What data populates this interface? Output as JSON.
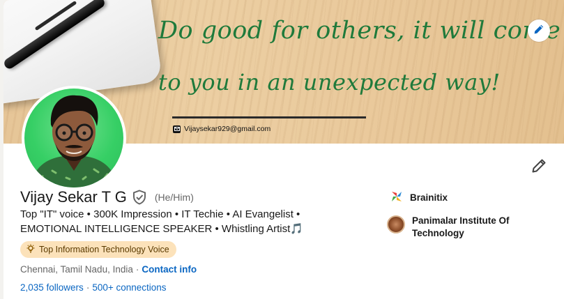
{
  "banner": {
    "quote_line1": "Do good for others, it will come back",
    "quote_line2": "to you in an unexpected way!",
    "email": "Vijaysekar929@gmail.com",
    "accent_color": "#1f7a3b"
  },
  "profile": {
    "name": "Vijay Sekar T G",
    "pronouns": "(He/Him)",
    "headline": "Top \"IT\" voice • 300K Impression • IT Techie • AI Evangelist • EMOTIONAL INTELLIGENCE SPEAKER • Whistling Artist",
    "headline_emoji": "🎵",
    "badge": "Top Information Technology Voice",
    "location": "Chennai, Tamil Nadu, India",
    "location_separator": "·",
    "contact_link": "Contact info",
    "followers": "2,035 followers",
    "stats_separator": "·",
    "connections": "500+ connections"
  },
  "organizations": [
    {
      "name": "Brainitix"
    },
    {
      "name": "Panimalar Institute Of Technology"
    }
  ],
  "icons": {
    "banner_edit": "pencil-icon",
    "profile_edit": "pencil-icon",
    "verified": "shield-check-icon",
    "badge": "lightbulb-icon",
    "email": "mail-icon"
  },
  "colors": {
    "link": "#0a66c2",
    "badge_bg": "#fce2ba",
    "avatar_bg": "#36cf65"
  }
}
